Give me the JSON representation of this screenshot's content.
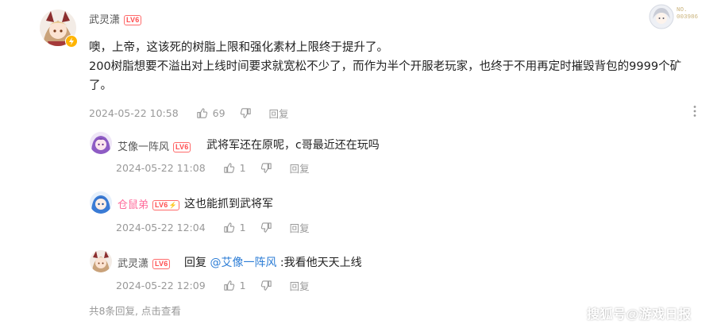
{
  "main_comment": {
    "username": "武灵潇",
    "level": "LV6",
    "lines": [
      "噢，上帝，这该死的树脂上限和强化素材上限终于提升了。",
      "200树脂想要不溢出对上线时间要求就宽松不少了，而作为半个开服老玩家，也终于不用再定时摧毁背包的9999个矿",
      "了。"
    ],
    "time": "2024-05-22 10:58",
    "likes": "69",
    "reply_label": "回复"
  },
  "medal": {
    "line1": "NO.",
    "line2": "003986"
  },
  "replies": [
    {
      "username": "艾像一阵风",
      "level": "LV6",
      "text": "武将军还在原呢，c哥最近还在玩吗",
      "time": "2024-05-22 11:08",
      "likes": "1",
      "reply_label": "回复"
    },
    {
      "username": "仓鼠弟",
      "level": "LV6",
      "text": "这也能抓到武将军",
      "time": "2024-05-22 12:04",
      "likes": "1",
      "reply_label": "回复"
    },
    {
      "username": "武灵潇",
      "level": "LV6",
      "reply_prefix": "回复",
      "mention": "@艾像一阵风",
      "text": ":我看他天天上线",
      "time": "2024-05-22 12:09",
      "likes": "1",
      "reply_label": "回复"
    }
  ],
  "footer": {
    "more_replies": "共8条回复, 点击查看"
  },
  "watermark": "搜狐号@游戏日报",
  "colors": {
    "level_badge": "#ff4d4f",
    "mention": "#2e7ed6",
    "meta": "#999999",
    "pink_name": "#ff6b9b"
  }
}
